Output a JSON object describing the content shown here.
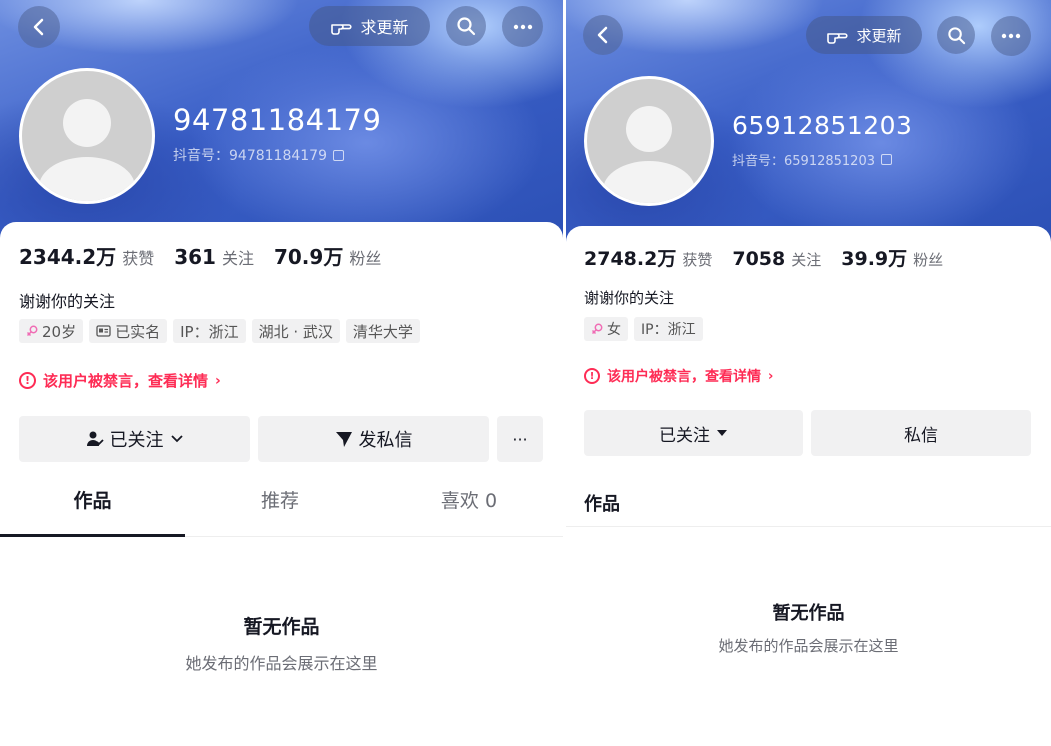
{
  "left": {
    "header": {
      "refresh_label": "求更新"
    },
    "profile": {
      "name": "94781184179",
      "douyin_id": "抖音号：94781184179",
      "stats": [
        {
          "value": "2344.2万",
          "label": "获赞"
        },
        {
          "value": "361",
          "label": "关注"
        },
        {
          "value": "70.9万",
          "label": "粉丝"
        }
      ],
      "bio": "谢谢你的关注",
      "tags": [
        "20岁",
        "已实名",
        "IP：浙江",
        "湖北 · 武汉",
        "清华大学"
      ]
    },
    "ban_notice": "该用户被禁言，查看详情",
    "actions": {
      "following": "已关注",
      "message": "发私信",
      "more": "···"
    },
    "tabs": [
      "作品",
      "推荐",
      "喜欢 0"
    ],
    "empty": {
      "title": "暂无作品",
      "subtitle": "她发布的作品会展示在这里"
    }
  },
  "right": {
    "header": {
      "refresh_label": "求更新"
    },
    "profile": {
      "name": "65912851203",
      "douyin_id": "抖音号：65912851203",
      "stats": [
        {
          "value": "2748.2万",
          "label": "获赞"
        },
        {
          "value": "7058",
          "label": "关注"
        },
        {
          "value": "39.9万",
          "label": "粉丝"
        }
      ],
      "bio": "谢谢你的关注",
      "tags": [
        "女",
        "IP：浙江"
      ]
    },
    "ban_notice": "该用户被禁言，查看详情",
    "actions": {
      "following": "已关注",
      "message": "私信"
    },
    "tabs": [
      "作品"
    ],
    "empty": {
      "title": "暂无作品",
      "subtitle": "她发布的作品会展示在这里"
    }
  },
  "colors": {
    "accent_red": "#fe2c55",
    "female_pink": "#f06cb4",
    "banner_blue": "#3a5fc7"
  },
  "icons": [
    "back-arrow-icon",
    "hand-pointer-icon",
    "search-icon",
    "more-dots-icon",
    "copy-icon",
    "female-icon",
    "id-card-icon",
    "warning-circle-icon",
    "person-check-icon",
    "chevron-down-icon",
    "send-plane-icon",
    "caret-down-icon"
  ]
}
